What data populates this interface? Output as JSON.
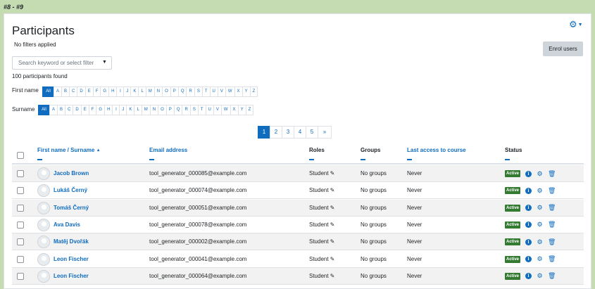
{
  "page_tag": "#8 - #9",
  "page": {
    "title": "Participants",
    "filters_status": "No filters applied",
    "enrol_button": "Enrol users",
    "search_placeholder": "Search keyword or select filter",
    "participants_count": "100 participants found"
  },
  "firstname_filter": {
    "label": "First name",
    "letters": [
      "All",
      "A",
      "B",
      "C",
      "D",
      "E",
      "F",
      "G",
      "H",
      "I",
      "J",
      "K",
      "L",
      "M",
      "N",
      "O",
      "P",
      "Q",
      "R",
      "S",
      "T",
      "U",
      "V",
      "W",
      "X",
      "Y",
      "Z"
    ]
  },
  "surname_filter": {
    "label": "Surname",
    "letters": [
      "All",
      "A",
      "B",
      "C",
      "D",
      "E",
      "F",
      "G",
      "H",
      "I",
      "J",
      "K",
      "L",
      "M",
      "N",
      "O",
      "P",
      "Q",
      "R",
      "S",
      "T",
      "U",
      "V",
      "W",
      "X",
      "Y",
      "Z"
    ]
  },
  "pagination": {
    "pages": [
      "1",
      "2",
      "3",
      "4",
      "5"
    ],
    "current": "1",
    "next": "»"
  },
  "table": {
    "headers": {
      "name": "First name / Surname",
      "email": "Email address",
      "roles": "Roles",
      "groups": "Groups",
      "last_access": "Last access to course",
      "status": "Status"
    },
    "rows": [
      {
        "name": "Jacob Brown",
        "email": "tool_generator_000085@example.com",
        "role": "Student",
        "groups": "No groups",
        "last_access": "Never",
        "status": "Active"
      },
      {
        "name": "Lukáš Černý",
        "email": "tool_generator_000074@example.com",
        "role": "Student",
        "groups": "No groups",
        "last_access": "Never",
        "status": "Active"
      },
      {
        "name": "Tomáš Černý",
        "email": "tool_generator_000051@example.com",
        "role": "Student",
        "groups": "No groups",
        "last_access": "Never",
        "status": "Active"
      },
      {
        "name": "Ava Davis",
        "email": "tool_generator_000078@example.com",
        "role": "Student",
        "groups": "No groups",
        "last_access": "Never",
        "status": "Active"
      },
      {
        "name": "Matěj Dvořák",
        "email": "tool_generator_000002@example.com",
        "role": "Student",
        "groups": "No groups",
        "last_access": "Never",
        "status": "Active"
      },
      {
        "name": "Leon Fischer",
        "email": "tool_generator_000041@example.com",
        "role": "Student",
        "groups": "No groups",
        "last_access": "Never",
        "status": "Active"
      },
      {
        "name": "Leon Fischer",
        "email": "tool_generator_000064@example.com",
        "role": "Student",
        "groups": "No groups",
        "last_access": "Never",
        "status": "Active"
      }
    ]
  },
  "colors": {
    "accent": "#0f6cbf",
    "active_badge": "#357a32",
    "background": "#c5dbb1"
  },
  "icons": {
    "settings": "gear-icon",
    "edit_role": "pencil-icon",
    "details": "info-icon",
    "edit_enrolment": "cog-icon",
    "unenrol": "trash-icon",
    "sort": "sort-asc-icon"
  }
}
